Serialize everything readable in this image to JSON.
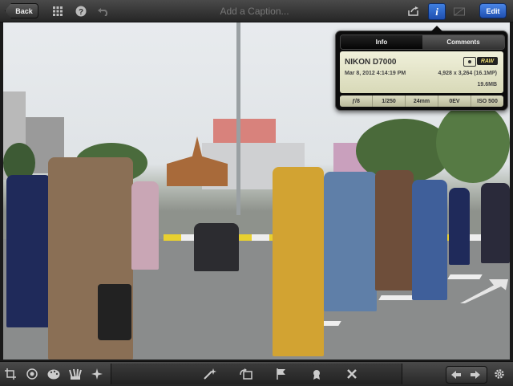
{
  "topbar": {
    "back_label": "Back",
    "caption_placeholder": "Add a Caption...",
    "edit_label": "Edit",
    "info_label": "i",
    "icons": [
      "grid-icon",
      "help-icon",
      "undo-icon",
      "share-icon",
      "info-icon",
      "compare-icon"
    ]
  },
  "info_panel": {
    "tabs": [
      {
        "label": "Info",
        "active": true
      },
      {
        "label": "Comments",
        "active": false
      }
    ],
    "camera": "NIKON D7000",
    "date": "Mar 8, 2012 4:14:19 PM",
    "dimensions": "4,928 x 3,264 (16.1MP)",
    "file_size": "19.6MB",
    "raw_badge": "RAW",
    "exif": [
      "ƒ/8",
      "1/250",
      "24mm",
      "0EV",
      "ISO 500"
    ]
  },
  "bottombar": {
    "left_tools": [
      "crop-icon",
      "exposure-icon",
      "palette-icon",
      "brushes-icon",
      "effects-icon"
    ],
    "mid_tools": [
      "auto-enhance-icon",
      "rotate-icon",
      "flag-icon",
      "favorite-icon",
      "reject-icon"
    ],
    "right_tools": [
      "prev-arrow-icon",
      "next-arrow-icon",
      "settings-gear-icon"
    ]
  },
  "colors": {
    "accent": "#2f6fd6",
    "bar": "#333333",
    "info_card": "#e6e6c8"
  }
}
